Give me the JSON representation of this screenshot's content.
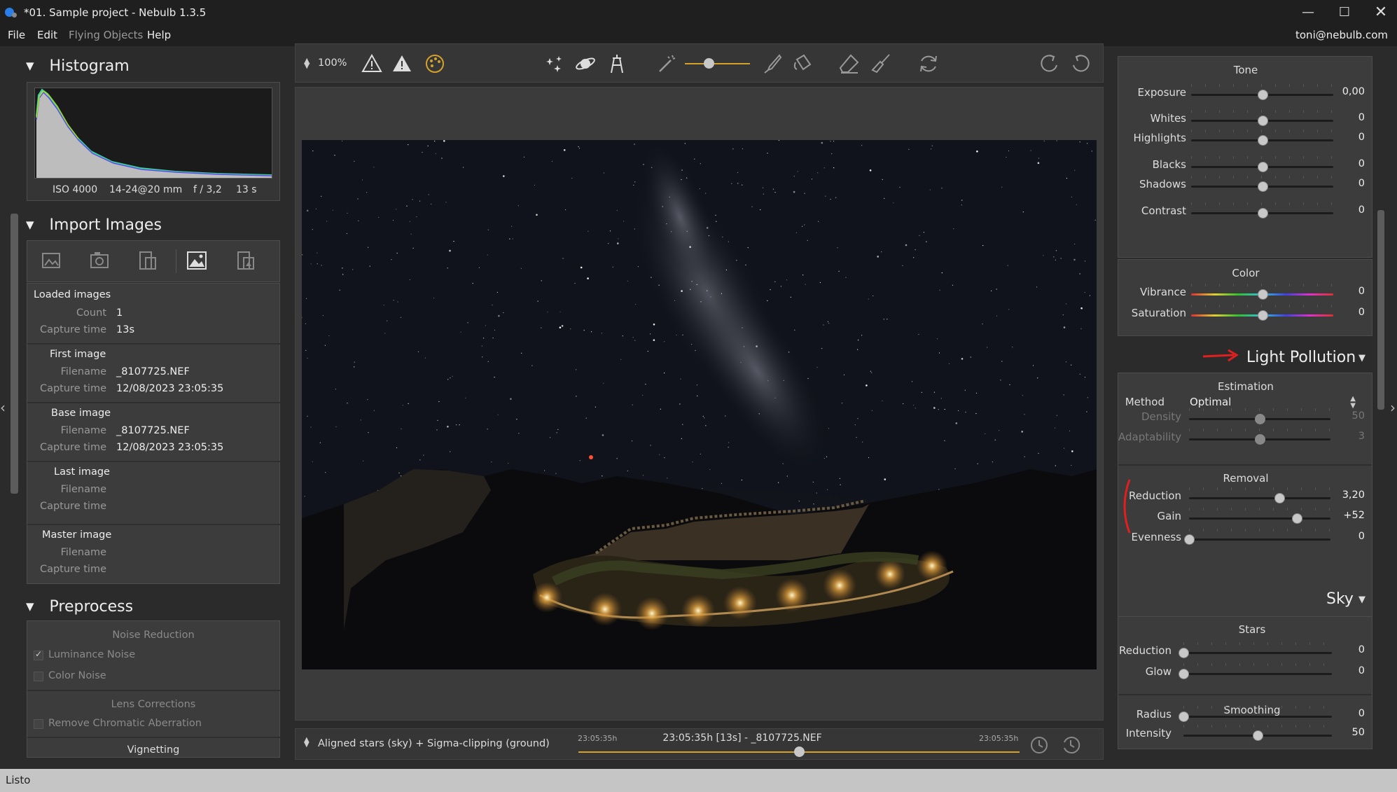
{
  "window": {
    "title": "*01. Sample project - Nebulb 1.3.5"
  },
  "menu": {
    "items": [
      "File",
      "Edit",
      "Flying Objects",
      "Help"
    ],
    "user": "toni@nebulb.com"
  },
  "histogram": {
    "title": "Histogram",
    "iso": "ISO 4000",
    "lens": "14-24@20 mm",
    "aperture": "f / 3,2",
    "exposure": "13 s"
  },
  "import": {
    "title": "Import Images",
    "loaded": {
      "title": "Loaded images",
      "count_label": "Count",
      "count": "1",
      "capture_label": "Capture time",
      "capture": "13s"
    },
    "first": {
      "title": "First image",
      "filename_label": "Filename",
      "filename": "_8107725.NEF",
      "capture_label": "Capture time",
      "capture": "12/08/2023 23:05:35"
    },
    "base": {
      "title": "Base image",
      "filename_label": "Filename",
      "filename": "_8107725.NEF",
      "capture_label": "Capture time",
      "capture": "12/08/2023 23:05:35"
    },
    "last": {
      "title": "Last image",
      "filename_label": "Filename",
      "capture_label": "Capture time"
    },
    "master": {
      "title": "Master image",
      "filename_label": "Filename",
      "capture_label": "Capture time"
    }
  },
  "preprocess": {
    "title": "Preprocess",
    "noise_title": "Noise Reduction",
    "luminance": "Luminance Noise",
    "luminance_checked": true,
    "color": "Color Noise",
    "color_checked": false,
    "lens_title": "Lens Corrections",
    "chromatic": "Remove Chromatic Aberration",
    "chromatic_checked": false,
    "vignetting": "Vignetting"
  },
  "toolbar": {
    "zoom": "100%"
  },
  "bottom": {
    "mode": "Aligned stars (sky) + Sigma-clipping (ground)",
    "time_start": "23:05:35h",
    "time_center": "23:05:35h [13s] - _8107725.NEF",
    "time_end": "23:05:35h",
    "position": 0.5
  },
  "tone": {
    "title": "Tone",
    "sliders": [
      {
        "label": "Exposure",
        "value": "0,00",
        "pos": 0.5
      },
      {
        "label": "Whites",
        "value": "0",
        "pos": 0.5
      },
      {
        "label": "Highlights",
        "value": "0",
        "pos": 0.5
      },
      {
        "label": "Blacks",
        "value": "0",
        "pos": 0.5
      },
      {
        "label": "Shadows",
        "value": "0",
        "pos": 0.5
      },
      {
        "label": "Contrast",
        "value": "0",
        "pos": 0.5
      }
    ]
  },
  "color": {
    "title": "Color",
    "sliders": [
      {
        "label": "Vibrance",
        "value": "0",
        "pos": 0.5
      },
      {
        "label": "Saturation",
        "value": "0",
        "pos": 0.5
      }
    ]
  },
  "light_pollution": {
    "title": "Light Pollution",
    "estimation_title": "Estimation",
    "method_label": "Method",
    "method_value": "Optimal",
    "estimation": [
      {
        "label": "Density",
        "value": "50",
        "pos": 0.5
      },
      {
        "label": "Adaptability",
        "value": "3",
        "pos": 0.5
      }
    ],
    "removal_title": "Removal",
    "removal": [
      {
        "label": "Reduction",
        "value": "3,20",
        "pos": 0.64
      },
      {
        "label": "Gain",
        "value": "+52",
        "pos": 0.76
      },
      {
        "label": "Evenness",
        "value": "0",
        "pos": 0.0
      }
    ]
  },
  "sky": {
    "title": "Sky",
    "stars_title": "Stars",
    "stars": [
      {
        "label": "Reduction",
        "value": "0",
        "pos": 0.0
      },
      {
        "label": "Glow",
        "value": "0",
        "pos": 0.0
      }
    ],
    "smoothing_title": "Smoothing",
    "smoothing": [
      {
        "label": "Radius",
        "value": "0",
        "pos": 0.0
      },
      {
        "label": "Intensity",
        "value": "50",
        "pos": 0.5
      }
    ]
  },
  "status": {
    "text": "Listo"
  },
  "colors": {
    "accent": "#d4a22a",
    "annotation": "#e02020",
    "window_bg": "#2b2b2b",
    "panel_bg": "#3c3c3c"
  }
}
